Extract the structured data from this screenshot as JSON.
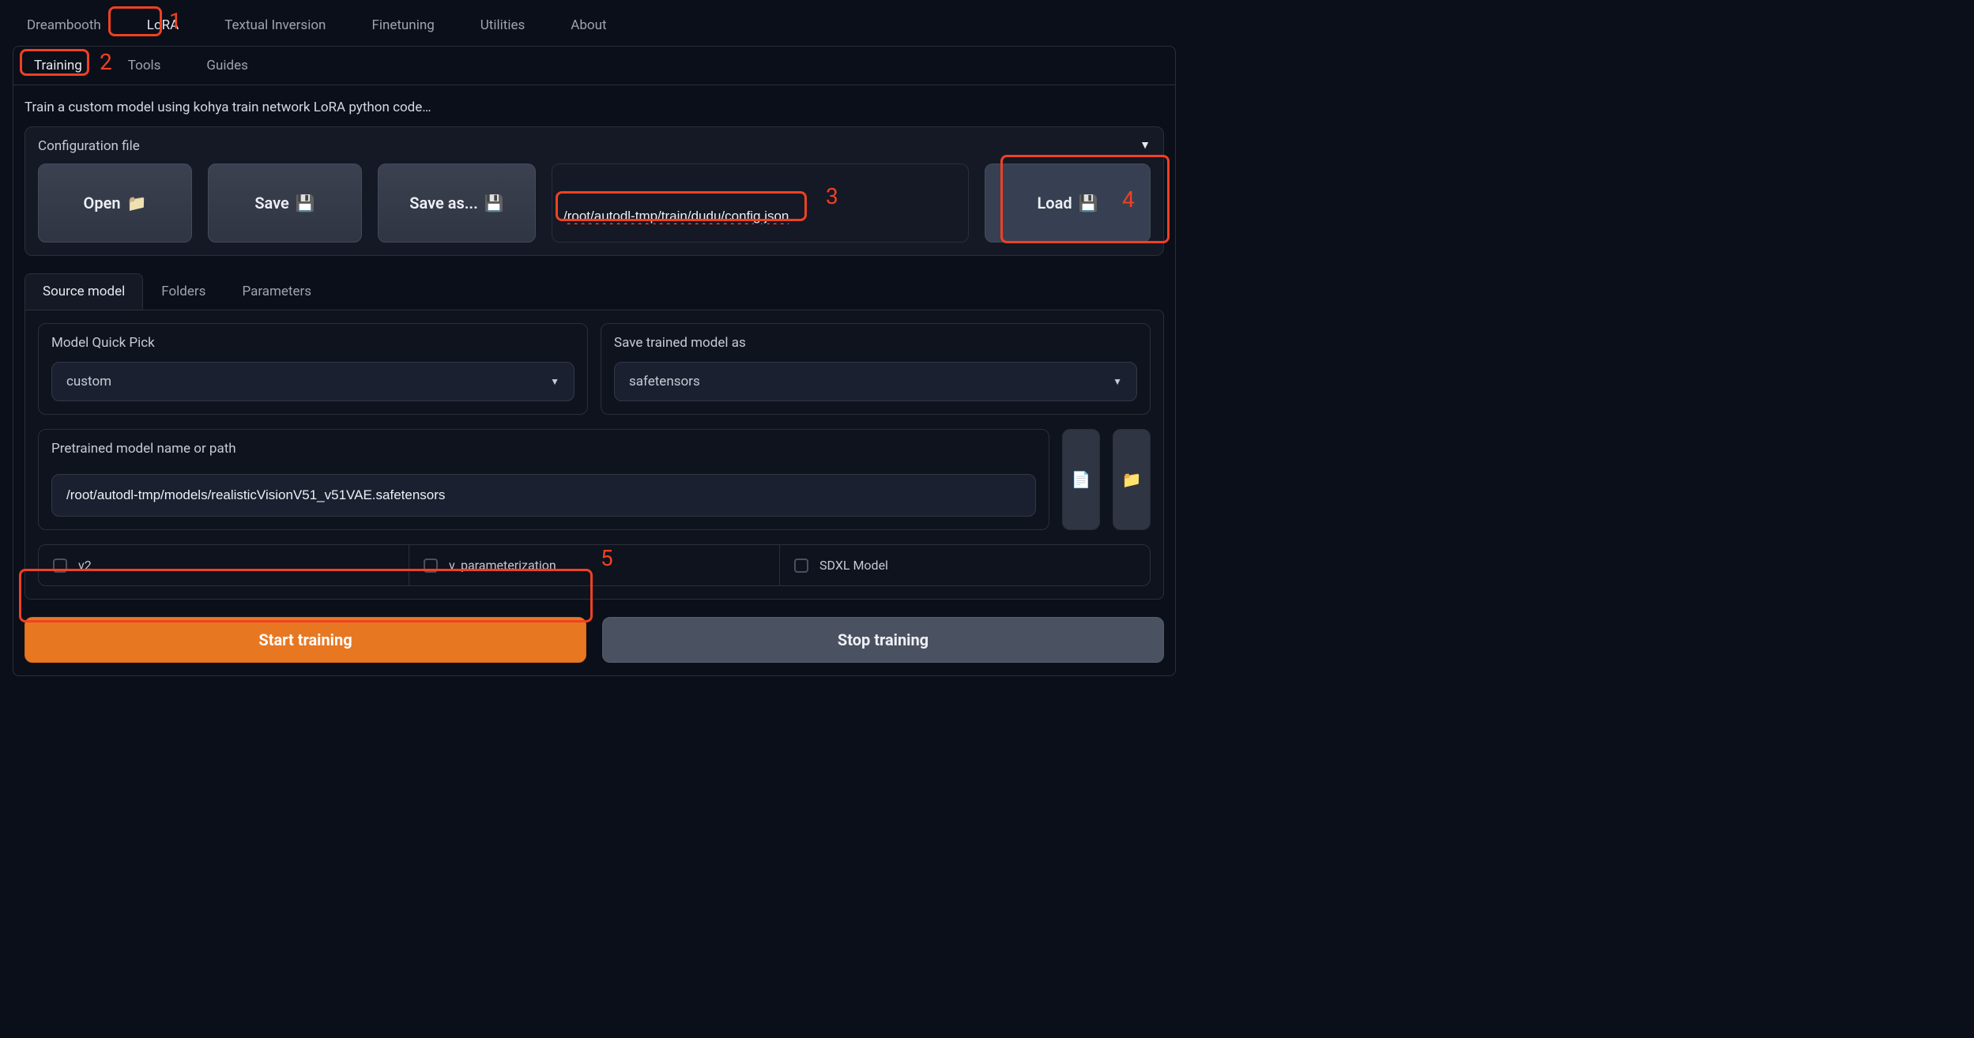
{
  "annotations": {
    "n1": "1",
    "n2": "2",
    "n3": "3",
    "n4": "4",
    "n5": "5"
  },
  "top_tabs": {
    "dreambooth": "Dreambooth",
    "lora": "LoRA",
    "textual_inversion": "Textual Inversion",
    "finetuning": "Finetuning",
    "utilities": "Utilities",
    "about": "About"
  },
  "sub_tabs": {
    "training": "Training",
    "tools": "Tools",
    "guides": "Guides"
  },
  "description": "Train a custom model using kohya train network LoRA python code…",
  "config": {
    "title": "Configuration file",
    "open": "Open",
    "save": "Save",
    "save_as": "Save as...",
    "load": "Load",
    "path": "/root/autodl-tmp/train/dudu/config.json",
    "collapse_icon": "▼"
  },
  "inner_tabs": {
    "source_model": "Source model",
    "folders": "Folders",
    "parameters": "Parameters"
  },
  "source": {
    "quick_pick_label": "Model Quick Pick",
    "quick_pick_value": "custom",
    "save_as_label": "Save trained model as",
    "save_as_value": "safetensors",
    "pretrained_label": "Pretrained model name or path",
    "pretrained_value": "/root/autodl-tmp/models/realisticVisionV51_v51VAE.safetensors",
    "checks": {
      "v2": "v2",
      "v_param": "v_parameterization",
      "sdxl": "SDXL Model"
    }
  },
  "actions": {
    "start": "Start training",
    "stop": "Stop training"
  }
}
